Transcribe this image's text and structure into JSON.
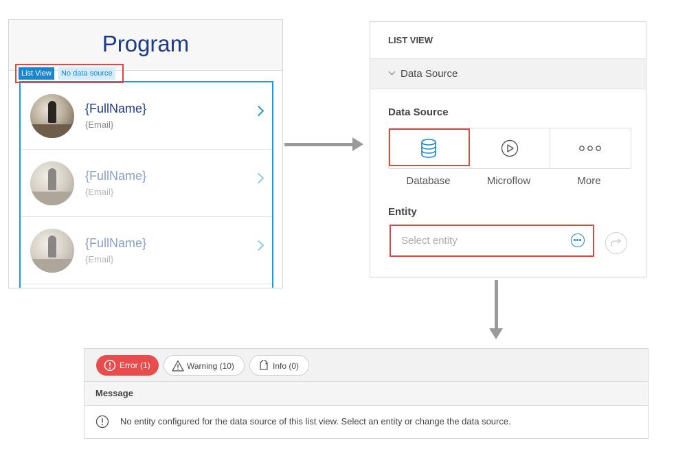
{
  "preview": {
    "title": "Program",
    "tag_widget": "List View",
    "tag_status": "No data source",
    "items": [
      {
        "name": "{FullName}",
        "email": "{Email}"
      },
      {
        "name": "{FullName}",
        "email": "{Email}"
      },
      {
        "name": "{FullName}",
        "email": "{Email}"
      }
    ]
  },
  "panel": {
    "title": "LIST VIEW",
    "section": "Data Source",
    "data_source_label": "Data Source",
    "options": [
      "Database",
      "Microflow",
      "More"
    ],
    "selected_option": "Database",
    "entity_label": "Entity",
    "entity_placeholder": "Select entity"
  },
  "errors": {
    "filters": {
      "error": "Error (1)",
      "warning": "Warning (10)",
      "info": "Info (0)"
    },
    "active_filter": "error",
    "column_header": "Message",
    "messages": [
      "No entity configured for the data source of this list view. Select an entity or change the data source."
    ]
  },
  "colors": {
    "accent": "#1a86d0",
    "highlight": "#e04545",
    "error_pill": "#e84c4c",
    "title": "#1f3a8a"
  },
  "icons": {
    "database": "database-icon",
    "microflow": "play-circle-icon",
    "more": "ellipsis-icon",
    "entity_select": "ellipsis-circle-icon",
    "go_to": "go-to-arrow-icon",
    "error": "exclamation-circle-icon",
    "warning": "warning-triangle-icon",
    "info": "info-tag-icon"
  }
}
